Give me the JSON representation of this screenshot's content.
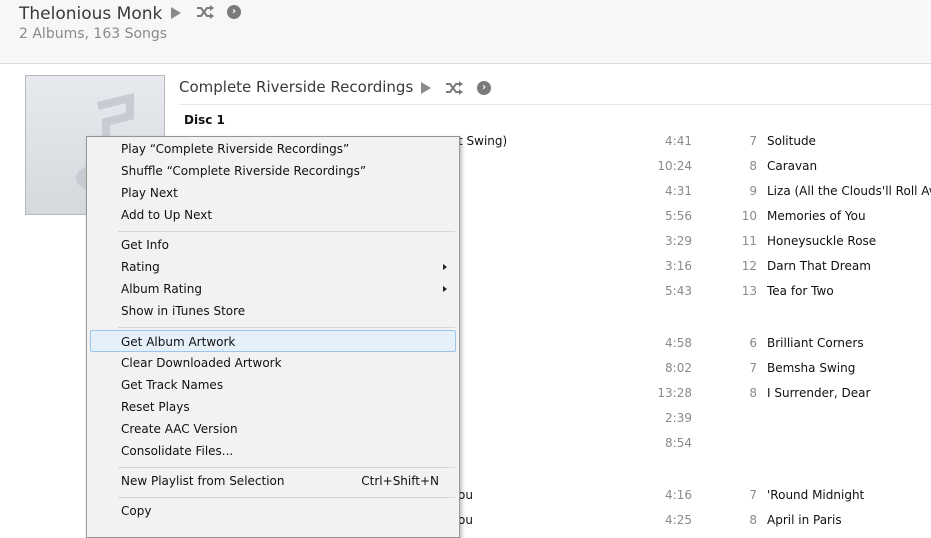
{
  "header": {
    "artist": "Thelonious Monk",
    "summary": "2 Albums, 163 Songs",
    "icons": [
      "play-icon",
      "shuffle-icon",
      "more-icon"
    ]
  },
  "album": {
    "title": "Complete Riverside Recordings",
    "disc_label": "Disc 1",
    "icons": [
      "album-art-placeholder-icon",
      "play-icon",
      "shuffle-icon",
      "more-icon"
    ]
  },
  "tracks": {
    "partial_left": [
      "t Swing)",
      "ou",
      "ou"
    ],
    "left_durations": [
      "4:41",
      "10:24",
      "4:31",
      "5:56",
      "3:29",
      "3:16",
      "5:43",
      "4:58",
      "8:02",
      "13:28",
      "2:39",
      "8:54",
      "4:16",
      "4:25"
    ],
    "right": [
      {
        "num": "7",
        "name": "Solitude"
      },
      {
        "num": "8",
        "name": "Caravan"
      },
      {
        "num": "9",
        "name": "Liza (All the Clouds'll Roll Av"
      },
      {
        "num": "10",
        "name": "Memories of You"
      },
      {
        "num": "11",
        "name": "Honeysuckle Rose"
      },
      {
        "num": "12",
        "name": "Darn That Dream"
      },
      {
        "num": "13",
        "name": "Tea for Two"
      },
      {
        "num": "6",
        "name": "Brilliant Corners"
      },
      {
        "num": "7",
        "name": "Bemsha Swing"
      },
      {
        "num": "8",
        "name": "I Surrender, Dear"
      },
      {
        "num": "7",
        "name": "'Round Midnight"
      },
      {
        "num": "8",
        "name": "April in Paris"
      }
    ]
  },
  "context_menu": {
    "items": [
      {
        "label": "Play “Complete Riverside Recordings”"
      },
      {
        "label": "Shuffle “Complete Riverside Recordings”"
      },
      {
        "label": "Play Next"
      },
      {
        "label": "Add to Up Next"
      },
      {
        "label": "Get Info"
      },
      {
        "label": "Rating",
        "submenu": true
      },
      {
        "label": "Album Rating",
        "submenu": true
      },
      {
        "label": "Show in iTunes Store"
      },
      {
        "label": "Get Album Artwork",
        "highlighted": true
      },
      {
        "label": "Clear Downloaded Artwork"
      },
      {
        "label": "Get Track Names"
      },
      {
        "label": "Reset Plays"
      },
      {
        "label": "Create AAC Version"
      },
      {
        "label": "Consolidate Files..."
      },
      {
        "label": "New Playlist from Selection",
        "shortcut": "Ctrl+Shift+N"
      },
      {
        "label": "Copy"
      }
    ],
    "highlight_color": "#e5f0fb"
  }
}
